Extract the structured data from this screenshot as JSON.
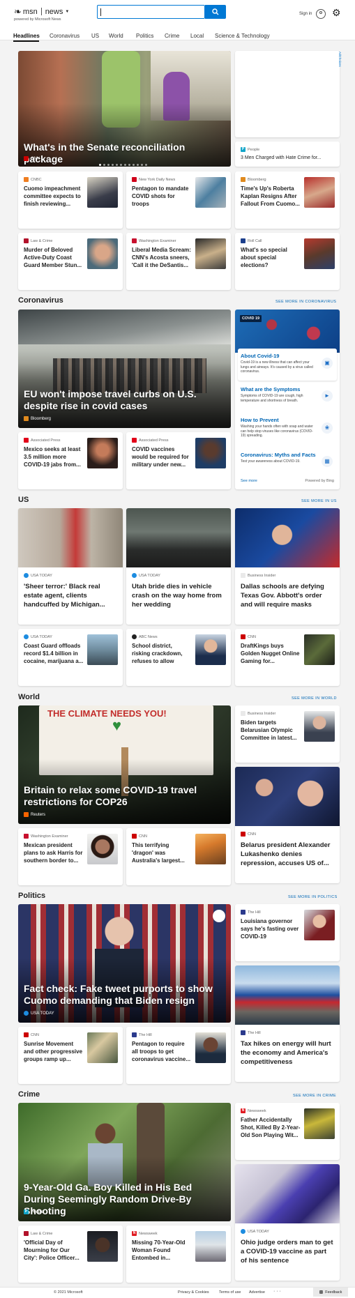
{
  "header": {
    "brand": "msn",
    "section": "news",
    "tagline": "powered by Microsoft News",
    "search_placeholder": "",
    "signin": "Sign in"
  },
  "nav": [
    "Headlines",
    "Coronavirus",
    "US",
    "World",
    "Politics",
    "Crime",
    "Local",
    "Science & Technology"
  ],
  "ad_label": "AdChoices",
  "headlines": {
    "hero": {
      "title": "What's in the Senate reconciliation package",
      "source": "CNN"
    },
    "side": {
      "source": "People",
      "title": "3 Men Charged with Hate Crime for..."
    },
    "row1": [
      {
        "source": "CNBC",
        "title": "Cuomo impeachment committee expects to finish reviewing..."
      },
      {
        "source": "New York Daily News",
        "title": "Pentagon to mandate COVID shots for troops"
      },
      {
        "source": "Bloomberg",
        "title": "Time's Up's Roberta Kaplan Resigns After Fallout From Cuomo..."
      }
    ],
    "row2": [
      {
        "source": "Law & Crime",
        "title": "Murder of Beloved Active-Duty Coast Guard Member Stun..."
      },
      {
        "source": "Washington Examiner",
        "title": "Liberal Media Scream: CNN's Acosta sneers, 'Call it the DeSantis..."
      },
      {
        "source": "Roll Call",
        "title": "What's so special about special elections?"
      }
    ]
  },
  "coronavirus": {
    "heading": "Coronavirus",
    "more": "SEE MORE IN CORONAVIRUS",
    "hero": {
      "title": "EU won't impose travel curbs on U.S. despite rise in covid cases",
      "source": "Bloomberg"
    },
    "cards": [
      {
        "source": "Associated Press",
        "title": "Mexico seeks at least 3.5 million more COVID-19 jabs from..."
      },
      {
        "source": "Associated Press",
        "title": "COVID vaccines would be required for military under new..."
      }
    ],
    "widget": {
      "badge": "COVID 19",
      "items": [
        {
          "title": "About Covid-19",
          "desc": "Covid-19 is a new illness that can affect your lungs and airways. It's caused by a virus called coronavirus."
        },
        {
          "title": "What are the Symptoms",
          "desc": "Symptoms of COVID-19 are cough, high temperature and shortness of breath."
        },
        {
          "title": "How to Prevent",
          "desc": "Washing your hands often with soap and water can help stop viruses like coronavirus (COVID-19) spreading."
        },
        {
          "title": "Coronavirus: Myths and Facts",
          "desc": "Test your awareness about COVID-19."
        }
      ],
      "see_more": "See more",
      "powered": "Powered by Bing"
    }
  },
  "us": {
    "heading": "US",
    "more": "SEE MORE IN US",
    "big": [
      {
        "source": "USA TODAY",
        "title": "'Sheer terror:' Black real estate agent, clients handcuffed by Michigan..."
      },
      {
        "source": "USA TODAY",
        "title": "Utah bride dies in vehicle crash on the way home from her wedding"
      },
      {
        "source": "Business Insider",
        "title": "Dallas schools are defying Texas Gov. Abbott's order and will require masks"
      }
    ],
    "small": [
      {
        "source": "USA TODAY",
        "title": "Coast Guard offloads record $1.4 billion in cocaine, marijuana a..."
      },
      {
        "source": "ABC News",
        "title": "School district, risking crackdown, refuses to allow students to op..."
      },
      {
        "source": "CNN",
        "title": "DraftKings buys Golden Nugget Online Gaming for..."
      }
    ]
  },
  "world": {
    "heading": "World",
    "more": "SEE MORE IN WORLD",
    "hero": {
      "title": "Britain to relax some COVID-19 travel restrictions for COP26",
      "source": "Reuters",
      "sign": "THE CLIMATE NEEDS YOU!"
    },
    "side_small": {
      "source": "Business Insider",
      "title": "Biden targets Belarusian Olympic Committee in latest..."
    },
    "side_big": {
      "source": "CNN",
      "title": "Belarus president Alexander Lukashenko denies repression, accuses US of..."
    },
    "cards": [
      {
        "source": "Washington Examiner",
        "title": "Mexican president plans to ask Harris for southern border to..."
      },
      {
        "source": "CNN",
        "title": "This terrifying 'dragon' was Australia's largest..."
      }
    ]
  },
  "politics": {
    "heading": "Politics",
    "more": "SEE MORE IN POLITICS",
    "hero": {
      "title": "Fact check: Fake tweet purports to show Cuomo demanding that Biden resign",
      "source": "USA TODAY"
    },
    "side_small": {
      "source": "The Hill",
      "title": "Louisiana governor says he's fasting over COVID-19"
    },
    "side_big": {
      "source": "The Hill",
      "title": "Tax hikes on energy will hurt the economy and America's competitiveness"
    },
    "cards": [
      {
        "source": "CNN",
        "title": "Sunrise Movement and other progressive groups ramp up..."
      },
      {
        "source": "The Hill",
        "title": "Pentagon to require all troops to get coronavirus vaccine..."
      }
    ]
  },
  "crime": {
    "heading": "Crime",
    "more": "SEE MORE IN CRIME",
    "hero": {
      "title": "9-Year-Old Ga. Boy Killed in His Bed During Seemingly Random Drive-By Shooting",
      "source": "People"
    },
    "side_small": {
      "source": "Newsweek",
      "title": "Father Accidentally Shot, Killed By 2-Year-Old Son Playing Wit..."
    },
    "side_big": {
      "source": "USA TODAY",
      "title": "Ohio judge orders man to get a COVID-19 vaccine as part of his sentence"
    },
    "cards": [
      {
        "source": "Law & Crime",
        "title": "'Official Day of Mourning for Our City': Police Officer..."
      },
      {
        "source": "Newsweek",
        "title": "Missing 70-Year-Old Woman Found Entombed in..."
      }
    ]
  },
  "footer": {
    "copyright": "© 2021 Microsoft",
    "links": [
      "Privacy & Cookies",
      "Terms of use",
      "Advertise"
    ],
    "more": "· · ·",
    "feedback": "Feedback"
  }
}
